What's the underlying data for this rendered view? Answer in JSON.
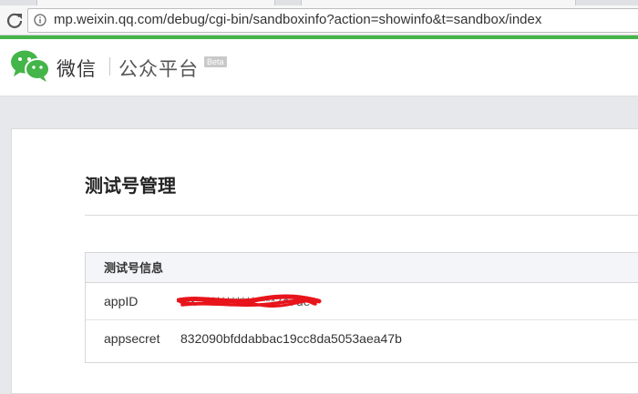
{
  "browser": {
    "url": "mp.weixin.qq.com/debug/cgi-bin/sandboxinfo?action=showinfo&t=sandbox/index"
  },
  "header": {
    "brand": "微信",
    "product": "公众平台",
    "beta": "Beta"
  },
  "main": {
    "title": "测试号管理",
    "info_box": {
      "heading": "测试号信息",
      "rows": [
        {
          "label": "appID",
          "value": "wx****************7c7de",
          "redacted": true
        },
        {
          "label": "appsecret",
          "value": "832090bfddabbac19cc8da5053aea47b",
          "redacted": false
        }
      ]
    }
  },
  "colors": {
    "wechat_green": "#44b549",
    "redaction_red": "#e8141b"
  }
}
